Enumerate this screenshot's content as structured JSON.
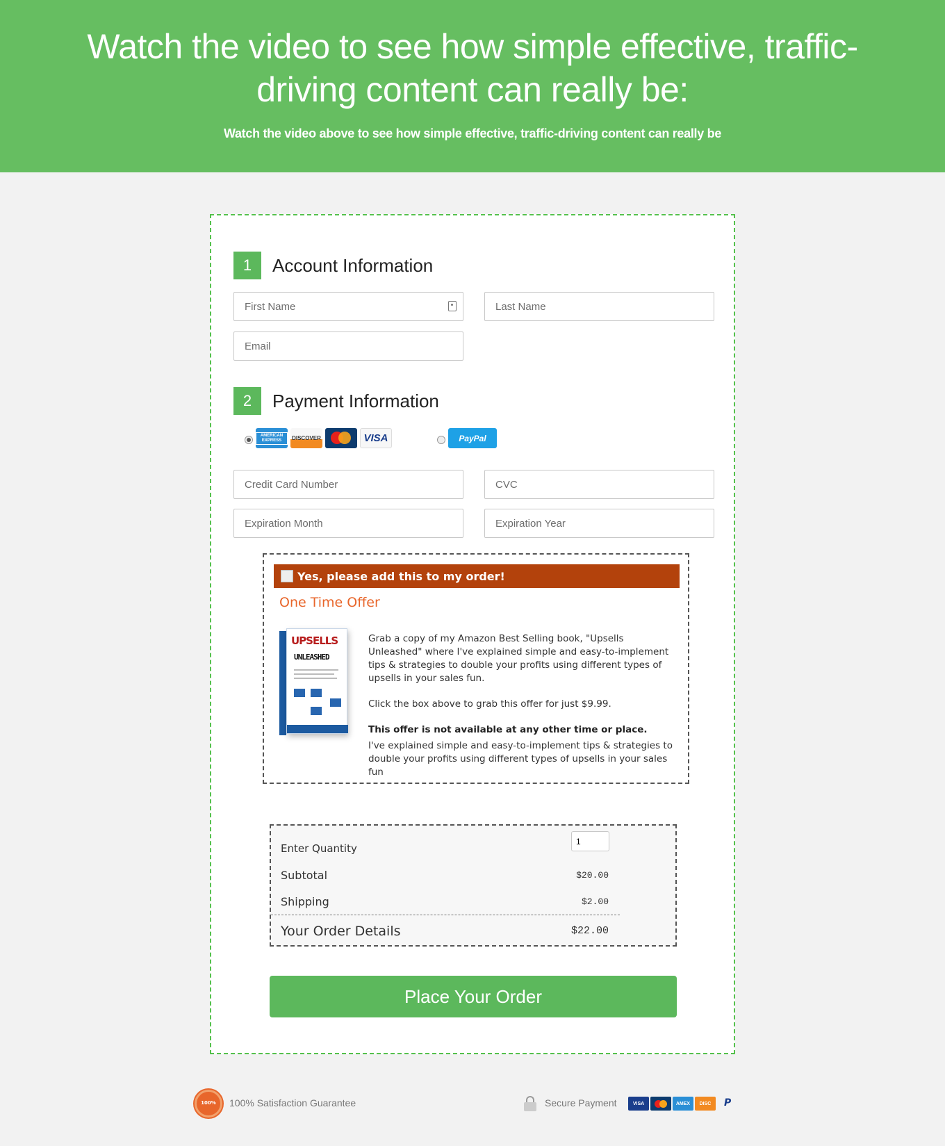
{
  "hero": {
    "headline": "Watch the video to see how simple effective, traffic-driving content can really be:",
    "subheadline": "Watch the video above to see how simple effective, traffic-driving content can really be",
    "bg_color": "#66be61"
  },
  "account": {
    "step_number": "1",
    "title": "Account Information",
    "first_name_placeholder": "First Name",
    "last_name_placeholder": "Last Name",
    "email_placeholder": "Email"
  },
  "payment": {
    "step_number": "2",
    "title": "Payment Information",
    "methods": [
      {
        "name": "credit-card",
        "selected": true,
        "cards": [
          "amex",
          "discover",
          "mastercard",
          "visa"
        ]
      },
      {
        "name": "paypal",
        "selected": false
      }
    ],
    "card_labels": {
      "amex": "AMERICAN EXPRESS",
      "discover": "DISCOVER",
      "visa": "VISA",
      "paypal": "PayPal"
    },
    "cc_number_placeholder": "Credit Card Number",
    "cvc_placeholder": "CVC",
    "exp_month_placeholder": "Expiration Month",
    "exp_year_placeholder": "Expiration Year"
  },
  "offer": {
    "checkbox_label": "Yes, please add this to my order!",
    "checked": false,
    "title": "One Time Offer",
    "book_title_1": "UPSELLS",
    "book_title_2": "UNLEASHED",
    "paragraph_1": "Grab a copy of my Amazon Best Selling book, \"Upsells Unleashed\" where I've explained simple and easy-to-implement tips & strategies to double your profits using different types of upsells in your sales fun.",
    "paragraph_2": "Click the box above to grab this offer for just $9.99.",
    "bold_note": "This offer is not available at any other time or place.",
    "paragraph_3": "I've explained simple and easy-to-implement tips & strategies to double your profits using different types of upsells in your sales fun",
    "bar_color": "#b3420c",
    "title_color": "#e8662b"
  },
  "summary": {
    "quantity_label": "Enter Quantity",
    "quantity_value": "1",
    "subtotal_label": "Subtotal",
    "subtotal_value": "$20.00",
    "shipping_label": "Shipping",
    "shipping_value": "$2.00",
    "total_label": "Your Order Details",
    "total_value": "$22.00"
  },
  "submit": {
    "label": "Place Your Order",
    "color": "#5cb85c"
  },
  "footer": {
    "guarantee": "100% Satisfaction Guarantee",
    "secure": "Secure Payment",
    "cards": [
      "visa",
      "mastercard",
      "amex",
      "discover",
      "paypal"
    ]
  }
}
